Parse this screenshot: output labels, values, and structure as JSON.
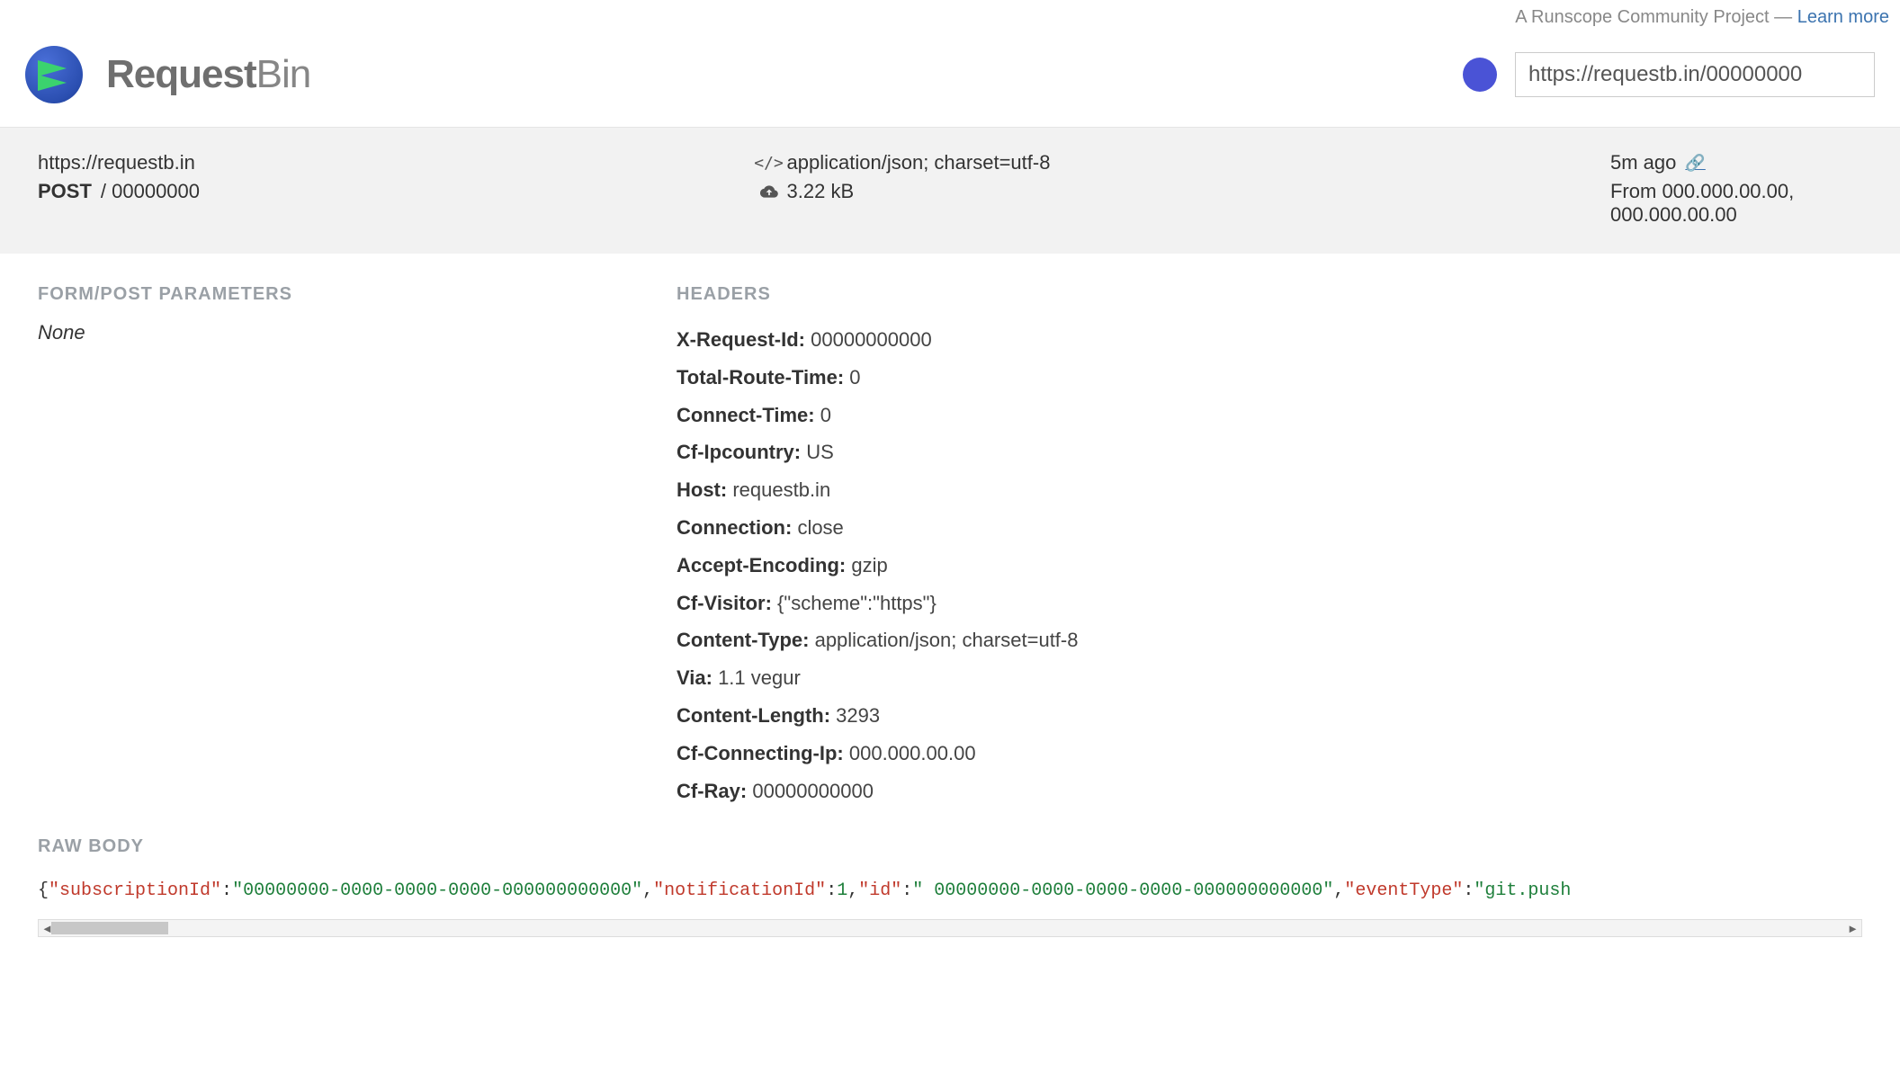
{
  "topbar": {
    "text": "A Runscope Community Project — ",
    "link": "Learn more"
  },
  "brand": {
    "bold": "Request",
    "light": "Bin"
  },
  "url_input": {
    "value": "https://requestb.in/00000000"
  },
  "summary": {
    "host": "https://requestb.in",
    "method": "POST",
    "path": " / 00000000",
    "content_type": "application/json; charset=utf-8",
    "size": "3.22 kB",
    "time_ago": "5m ago",
    "from_label": "From ",
    "from_ips": "000.000.00.00, 000.000.00.00"
  },
  "sections": {
    "form_params_title": "FORM/POST PARAMETERS",
    "form_params_none": "None",
    "headers_title": "HEADERS",
    "raw_body_title": "RAW BODY"
  },
  "headers": [
    {
      "k": "X-Request-Id:",
      "v": "00000000000"
    },
    {
      "k": "Total-Route-Time:",
      "v": "0"
    },
    {
      "k": "Connect-Time:",
      "v": "0"
    },
    {
      "k": "Cf-Ipcountry:",
      "v": "US"
    },
    {
      "k": "Host:",
      "v": "requestb.in"
    },
    {
      "k": "Connection:",
      "v": "close"
    },
    {
      "k": "Accept-Encoding:",
      "v": "gzip"
    },
    {
      "k": "Cf-Visitor:",
      "v": "{\"scheme\":\"https\"}"
    },
    {
      "k": "Content-Type:",
      "v": "application/json; charset=utf-8"
    },
    {
      "k": "Via:",
      "v": "1.1 vegur"
    },
    {
      "k": "Content-Length:",
      "v": "3293"
    },
    {
      "k": "Cf-Connecting-Ip:",
      "v": "000.000.00.00"
    },
    {
      "k": "Cf-Ray:",
      "v": "00000000000"
    }
  ],
  "raw_body_tokens": [
    {
      "t": "p",
      "v": "{"
    },
    {
      "t": "k",
      "v": "\"subscriptionId\""
    },
    {
      "t": "p",
      "v": ":"
    },
    {
      "t": "s",
      "v": "\"00000000-0000-0000-0000-000000000000\""
    },
    {
      "t": "p",
      "v": ","
    },
    {
      "t": "k",
      "v": "\"notificationId\""
    },
    {
      "t": "p",
      "v": ":"
    },
    {
      "t": "n",
      "v": "1"
    },
    {
      "t": "p",
      "v": ","
    },
    {
      "t": "k",
      "v": "\"id\""
    },
    {
      "t": "p",
      "v": ":"
    },
    {
      "t": "s",
      "v": "\" 00000000-0000-0000-0000-000000000000\""
    },
    {
      "t": "p",
      "v": ","
    },
    {
      "t": "k",
      "v": "\"eventType\""
    },
    {
      "t": "p",
      "v": ":"
    },
    {
      "t": "s",
      "v": "\"git.push"
    }
  ]
}
